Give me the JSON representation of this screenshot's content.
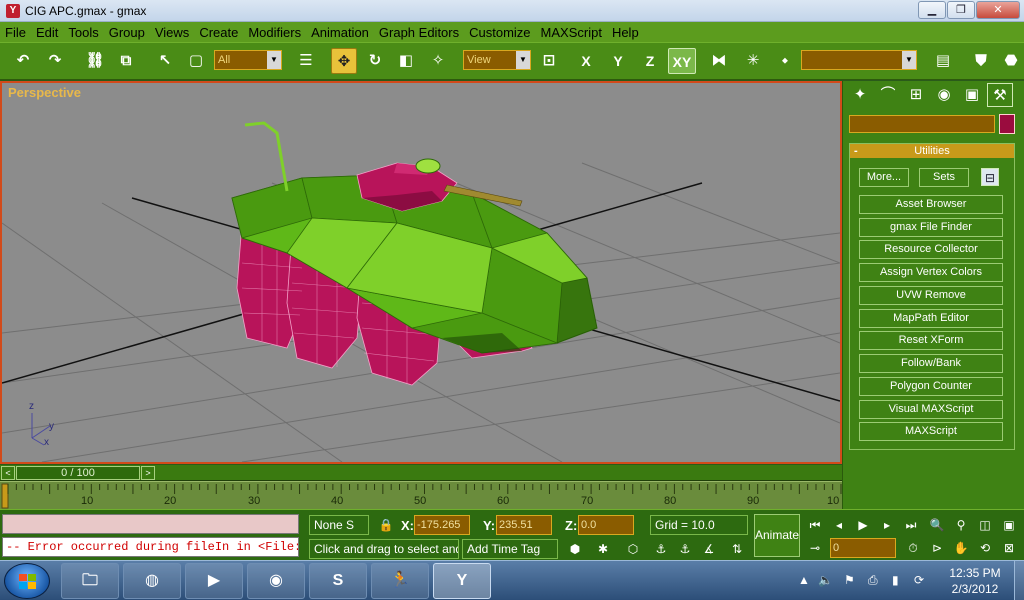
{
  "window": {
    "title": "CIG APC.gmax - gmax",
    "minimize": "▁",
    "maximize": "❐",
    "close": "✕"
  },
  "menu": [
    "File",
    "Edit",
    "Tools",
    "Group",
    "Views",
    "Create",
    "Modifiers",
    "Animation",
    "Graph Editors",
    "Customize",
    "MAXScript",
    "Help"
  ],
  "toolbar": {
    "selection_filter": "All",
    "reference_coord": "View",
    "named_selection": "",
    "axes": [
      "X",
      "Y",
      "Z",
      "XY"
    ]
  },
  "viewport": {
    "label": "Perspective",
    "axis_labels": [
      "z",
      "y",
      "x"
    ]
  },
  "timeline": {
    "frame_display": "0 / 100",
    "prev": "<",
    "next": ">",
    "ticks": [
      "10",
      "20",
      "30",
      "40",
      "50",
      "60",
      "70",
      "80",
      "90",
      "10"
    ]
  },
  "command_panel": {
    "rollout_title": "Utilities",
    "rollout_minus": "-",
    "more_button": "More...",
    "sets_button": "Sets",
    "utilities": [
      "Asset Browser",
      "gmax File Finder",
      "Resource Collector",
      "Assign Vertex Colors",
      "UVW Remove",
      "MapPath Editor",
      "Reset XForm",
      "Follow/Bank",
      "Polygon Counter",
      "Visual MAXScript",
      "MAXScript"
    ]
  },
  "status": {
    "listener_output": "-- Error occurred during fileIn in <File:C",
    "selection_status": "None S",
    "prompt": "Click and drag to select and m",
    "add_time_tag": "Add Time Tag",
    "x_label": "X:",
    "x_value": "-175.265",
    "y_label": "Y:",
    "y_value": "235.51",
    "z_label": "Z:",
    "z_value": "0.0",
    "grid": "Grid = 10.0",
    "animate": "Animate",
    "current_frame": "0"
  },
  "taskbar": {
    "clock_time": "12:35 PM",
    "clock_date": "2/3/2012"
  },
  "colors": {
    "interface_green": "#4a8c16",
    "viewport_gray": "#8c8c8c",
    "active_border": "#d24a1a",
    "hull_green": "#5fb818",
    "wheel_magenta": "#b8145a",
    "field_brown": "#8a5c00"
  }
}
